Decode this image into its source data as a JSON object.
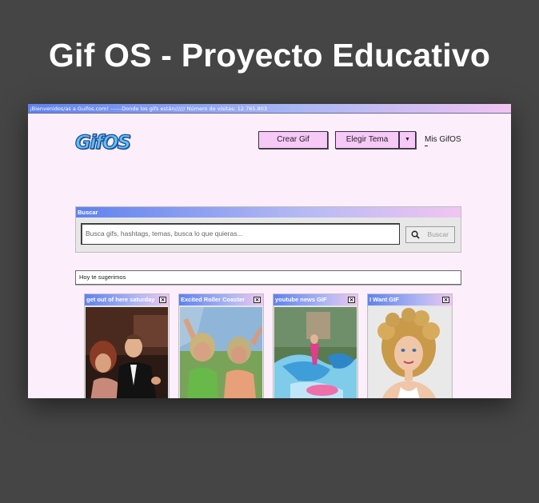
{
  "promo": {
    "headline": "Gif OS - Proyecto Educativo"
  },
  "topbar": {
    "text": "¡Bienvenidos/as a Guifos.com! ------Donde los gifs están////// Número de visitas: 12.765.803"
  },
  "header": {
    "logo_text": "GifOS",
    "crear_label": "Crear Gif",
    "tema_label": "Elegir Tema",
    "tema_arrow": "▼",
    "mis_gifos_label": "Mis GifOS"
  },
  "search": {
    "title": "Buscar",
    "placeholder": "Busca gifs, hashtags, temas, busca lo que quieras...",
    "button_label": "Buscar",
    "button_icon": "search-icon"
  },
  "suggestions": {
    "title": "Hoy te sugerimos",
    "close_glyph": "×",
    "cards": [
      {
        "title": "get out of here saturday"
      },
      {
        "title": "Excited Roller Coaster"
      },
      {
        "title": "youtube news GIF"
      },
      {
        "title": "I Want GIF"
      }
    ]
  },
  "colors": {
    "background": "#454545",
    "page": "#fdeefc",
    "button": "#f7c9f7",
    "gradient_start": "#5f82ef",
    "gradient_end": "#f2c4f2",
    "logo": "#5ec1f2"
  }
}
